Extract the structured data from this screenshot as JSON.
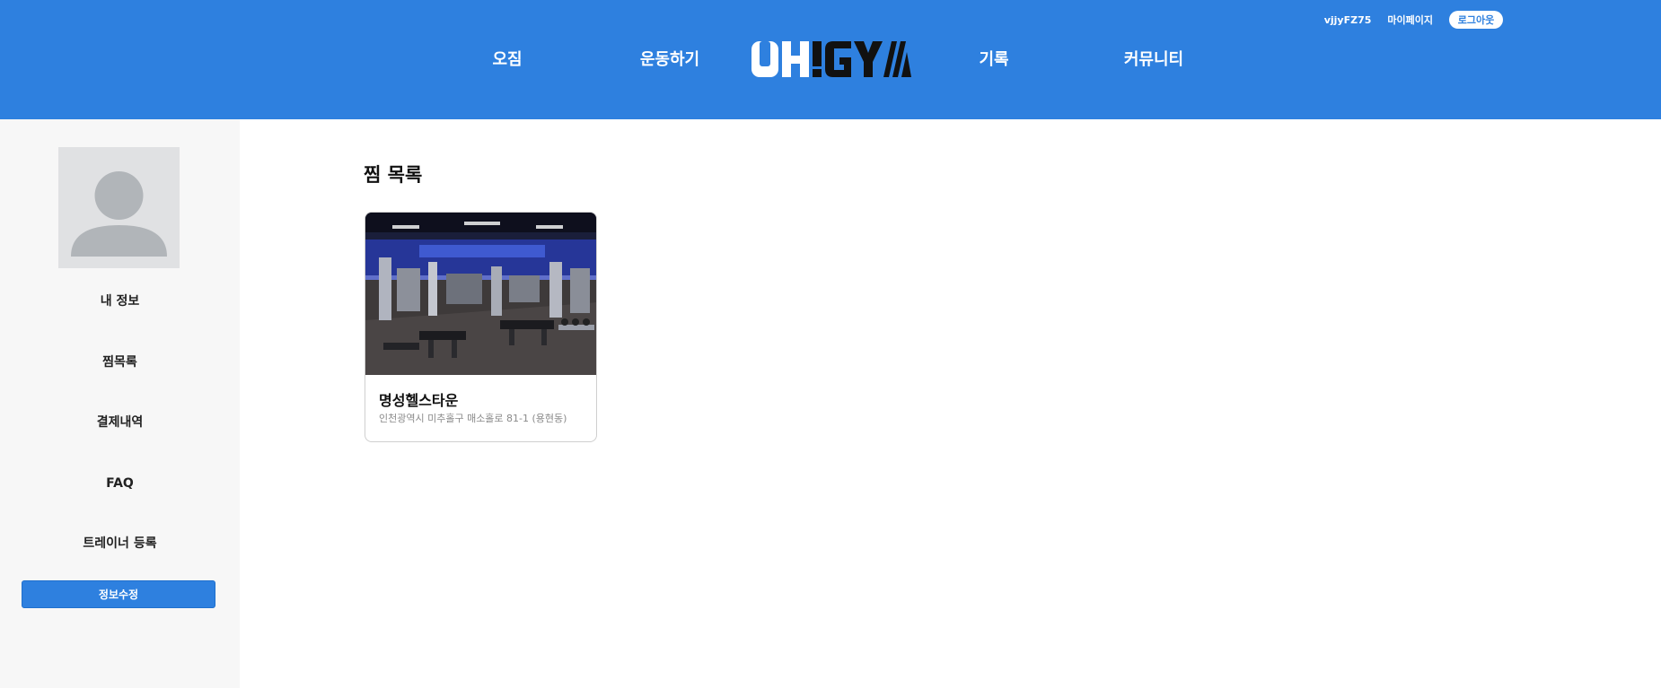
{
  "header": {
    "user_id": "vjjyFZ75",
    "mypage_label": "마이페이지",
    "logout_label": "로그아웃",
    "nav": {
      "ojim": "오짐",
      "workout": "운동하기",
      "record": "기록",
      "community": "커뮤니티"
    },
    "logo": {
      "text": "OH!GYM"
    }
  },
  "sidebar": {
    "avatar_icon": "default-user-avatar-icon",
    "items": [
      "내 정보",
      "찜목록",
      "결제내역",
      "FAQ",
      "트레이너 등록"
    ],
    "edit_button_label": "정보수정"
  },
  "main": {
    "title": "찜 목록",
    "wishlist": [
      {
        "name": "명성헬스타운",
        "address": "인천광역시 미추홀구 매소홀로 81-1 (용현동)",
        "image": "gym-interior-photo"
      }
    ]
  },
  "colors": {
    "primary": "#2e80df",
    "sidebar_bg": "#f7f7f7",
    "white": "#ffffff"
  }
}
